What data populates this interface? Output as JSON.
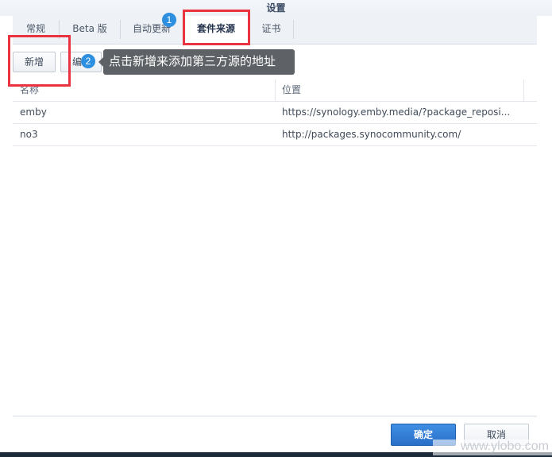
{
  "window": {
    "title": "设置"
  },
  "tabs": [
    {
      "label": "常规"
    },
    {
      "label": "Beta 版"
    },
    {
      "label": "自动更新"
    },
    {
      "label": "套件来源"
    },
    {
      "label": "证书"
    }
  ],
  "annotations": {
    "badge_1": "1",
    "badge_2": "2",
    "tooltip": "点击新增来添加第三方源的地址"
  },
  "toolbar": {
    "add_label": "新增",
    "edit_label_partial": "编"
  },
  "table": {
    "columns": [
      "名称",
      "位置"
    ],
    "rows": [
      {
        "name": "emby",
        "location": "https://synology.emby.media/?package_reposi..."
      },
      {
        "name": "no3",
        "location": "http://packages.synocommunity.com/"
      }
    ]
  },
  "footer": {
    "ok_label": "确定",
    "cancel_label": "取消"
  },
  "watermark": "www.ylobo.com",
  "colors": {
    "accent": "#2d8fe0",
    "highlight_box": "#ea3340",
    "primary_button": "#2a6fc8",
    "tooltip_bg": "#5e6266"
  }
}
